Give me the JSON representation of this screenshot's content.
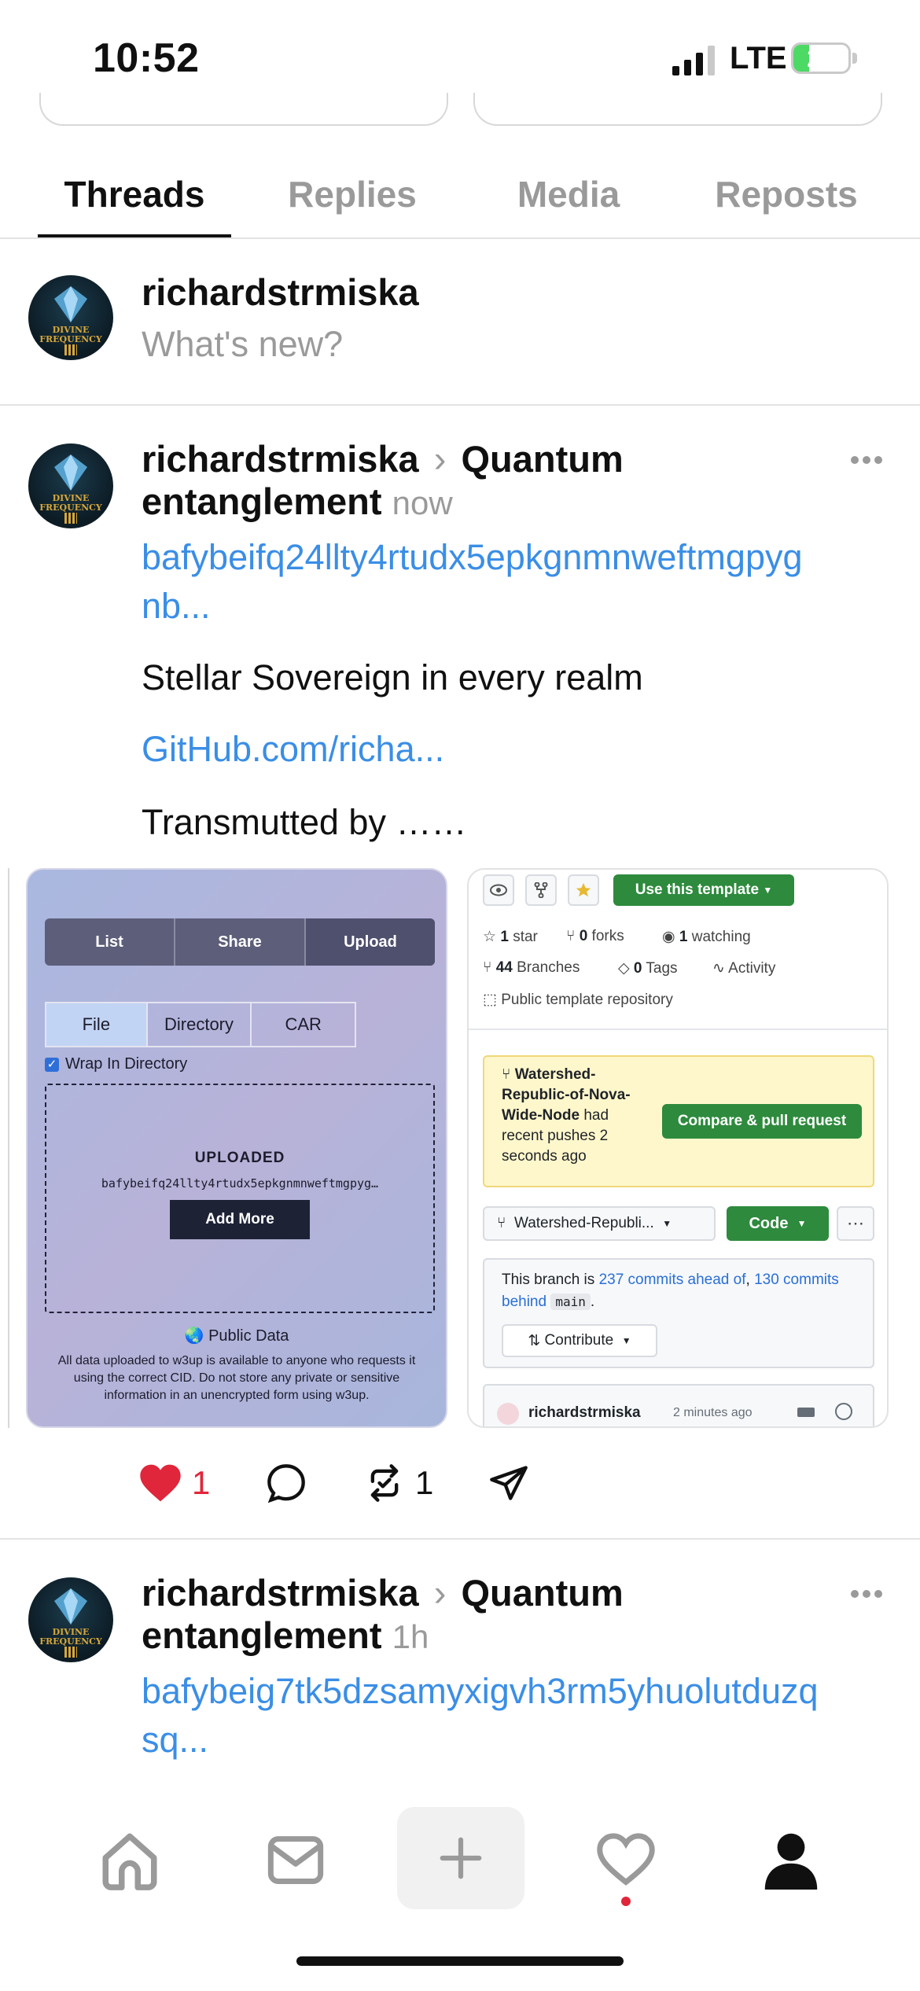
{
  "status_bar": {
    "time": "10:52",
    "network": "LTE",
    "battery": "29",
    "battery_level": 0.29
  },
  "tabs": [
    {
      "label": "Threads",
      "active": true
    },
    {
      "label": "Replies",
      "active": false
    },
    {
      "label": "Media",
      "active": false
    },
    {
      "label": "Reposts",
      "active": false
    }
  ],
  "composer": {
    "username": "richardstrmiska",
    "placeholder": "What's new?"
  },
  "avatar": {
    "line1": "DIVINE",
    "line2": "FREQUENCY"
  },
  "posts": [
    {
      "username": "richardstrmiska",
      "separator": "›",
      "topic_first": "Quantum",
      "topic_second": "entanglement",
      "time": "now",
      "cid_line1": "bafybeifq24llty4rtudx5epkgnmnweftmgpyg",
      "cid_line2": "nb...",
      "text1": "Stellar Sovereign in every realm",
      "link": "GitHub.com/richa...",
      "text2": "Transmutted by ……",
      "likes": "1",
      "reposts": "1",
      "liked": true
    },
    {
      "username": "richardstrmiska",
      "separator": "›",
      "topic_first": "Quantum",
      "topic_second": "entanglement",
      "time": "1h",
      "cid_line1": "bafybeig7tk5dzsamyxigvh3rm5yhuolutduzq",
      "cid_line2": "sq..."
    }
  ],
  "upload_card": {
    "tabs": [
      "List",
      "Share",
      "Upload"
    ],
    "types": [
      "File",
      "Directory",
      "CAR"
    ],
    "wrap_label": "Wrap In Directory",
    "uploaded_title": "UPLOADED",
    "uploaded_cid": "bafybeifq24llty4rtudx5epkgnmnweftmgpyg…",
    "add_more": "Add More",
    "public_title": "Public Data",
    "public_text": "All data uploaded to w3up is available to anyone who requests it using the correct CID. Do not store any private or sensitive information in an unencrypted form using w3up."
  },
  "github_card": {
    "use_template": "Use this template",
    "stars_count": "1",
    "stars_label": "star",
    "forks_count": "0",
    "forks_label": "forks",
    "watching_count": "1",
    "watching_label": "watching",
    "branches_count": "44",
    "branches_label": "Branches",
    "tags_count": "0",
    "tags_label": "Tags",
    "activity": "Activity",
    "repo_type": "Public template repository",
    "banner_branch": "Watershed-Republic-of-Nova-Wide-Node",
    "banner_rest": "had recent pushes 2 seconds ago",
    "compare": "Compare & pull request",
    "branch_select": "Watershed-Republi...",
    "code": "Code",
    "ahead_prefix": "This branch is",
    "ahead_link": "237 commits ahead of",
    "behind_link": "130 commits behind",
    "base_branch": "main",
    "contribute": "Contribute",
    "commit_user": "richardstrmiska",
    "commit_time": "2 minutes ago"
  },
  "colors": {
    "accent_blue": "#3a8ee6",
    "like_red": "#e0263a",
    "github_green": "#2e8a3d"
  }
}
